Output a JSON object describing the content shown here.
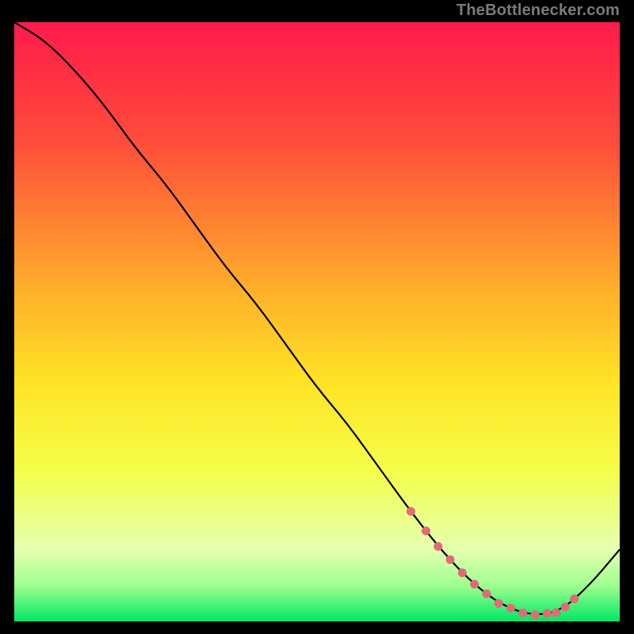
{
  "attribution": "TheBottlenecker.com",
  "chart_data": {
    "type": "line",
    "title": "",
    "xlabel": "",
    "ylabel": "",
    "xlim": [
      0,
      100
    ],
    "ylim": [
      0,
      100
    ],
    "gradient_stops": [
      {
        "offset": 0,
        "color": "#ff1a4b"
      },
      {
        "offset": 20,
        "color": "#ff4d3a"
      },
      {
        "offset": 45,
        "color": "#ffb02a"
      },
      {
        "offset": 60,
        "color": "#ffe325"
      },
      {
        "offset": 75,
        "color": "#f4ff4a"
      },
      {
        "offset": 88,
        "color": "#e5ffb0"
      },
      {
        "offset": 94,
        "color": "#9fff8f"
      },
      {
        "offset": 100,
        "color": "#00e864"
      }
    ],
    "series": [
      {
        "name": "bottleneck-curve",
        "color": "#000000",
        "x": [
          0,
          5,
          10,
          15,
          20,
          25,
          30,
          35,
          40,
          45,
          50,
          55,
          60,
          65,
          70,
          75,
          80,
          85,
          90,
          95,
          100
        ],
        "values": [
          100,
          97,
          92,
          86,
          79,
          73,
          66,
          59,
          53,
          46,
          39,
          33,
          26,
          19,
          12.5,
          7,
          3,
          1.0,
          1.5,
          6,
          12
        ]
      }
    ],
    "annotations": {
      "marker_color": "#e36a78",
      "marker_radius": 5.5,
      "markers_x": [
        65.5,
        68,
        70,
        72,
        74,
        76,
        78,
        80,
        82,
        84,
        86,
        88,
        89.5,
        91,
        92.5
      ]
    }
  }
}
